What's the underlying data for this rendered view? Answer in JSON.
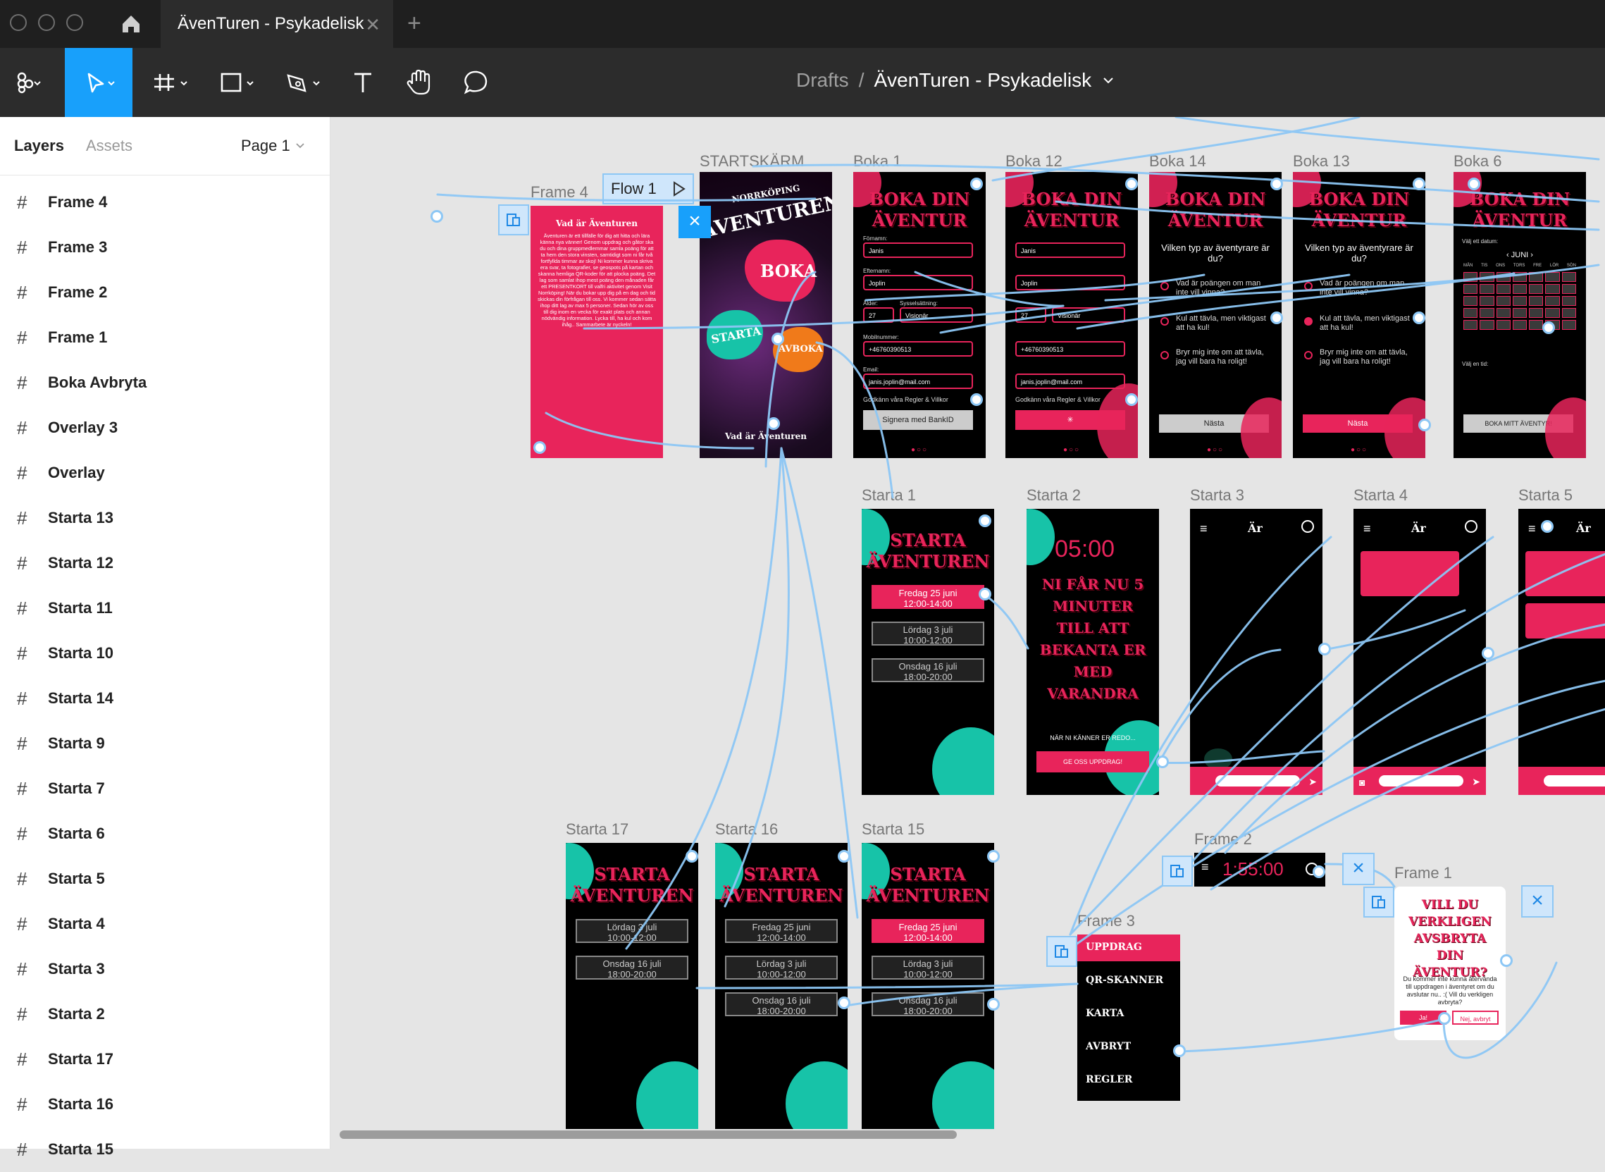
{
  "window": {
    "tab_title": "ÄvenTuren - Psykadelisk",
    "tab_close": "✕",
    "new_tab": "+"
  },
  "toolbar": {
    "breadcrumb_root": "Drafts",
    "breadcrumb_sep": "/",
    "file_name": "ÄvenTuren - Psykadelisk"
  },
  "panel": {
    "tab_layers": "Layers",
    "tab_assets": "Assets",
    "page_selector": "Page 1",
    "layers": [
      "Frame 4",
      "Frame 3",
      "Frame 2",
      "Frame 1",
      "Boka Avbryta",
      "Overlay 3",
      "Overlay",
      "Starta 13",
      "Starta 12",
      "Starta 11",
      "Starta 10",
      "Starta 14",
      "Starta 9",
      "Starta 7",
      "Starta 6",
      "Starta 5",
      "Starta 4",
      "Starta 3",
      "Starta 2",
      "Starta 17",
      "Starta 16",
      "Starta 15"
    ]
  },
  "canvas": {
    "flow_label": "Flow 1",
    "frame_labels": {
      "frame4": "Frame 4",
      "startskarm": "STARTSKÄRM",
      "boka1": "Boka 1",
      "boka12": "Boka 12",
      "boka14": "Boka 14",
      "boka13": "Boka 13",
      "boka6": "Boka 6",
      "starta1": "Starta 1",
      "starta2": "Starta 2",
      "starta3": "Starta 3",
      "starta4": "Starta 4",
      "starta5": "Starta 5",
      "starta17": "Starta 17",
      "starta16": "Starta 16",
      "starta15": "Starta 15",
      "frame2": "Frame 2",
      "frame3": "Frame 3",
      "frame1": "Frame 1"
    },
    "frame4": {
      "heading": "Vad är Äventuren",
      "body": "Äventuren är ett tillfälle för dig att hitta och lära känna nya vänner! Genom uppdrag och gåtor ska du och dina gruppmedlemmar samla poäng för att ta hem den stora vinsten, samtidigt som ni får två fortfyllda timmar av skoj! Ni kommer kunna skriva era svar, ta fotografier, se geospots på kartan och skanna hemliga QR-koder för att plocka poäng. Det lag som samlat ihop mest poäng den månaden får ett PRESENTKORT till valfri aktivitet genom Visit Norrköping! När du bokar upp dig på en dag och tid skickas din förfrågan till oss. Vi kommer sedan sätta ihop ditt lag av max 5 personer. Sedan hör av oss till dig inom en vecka för exakt plats och annan nödvändig information. Lycka till, ha kul och kom ihåg.. Sammarbete är nyckeln!"
    },
    "startskarm": {
      "top": "NORRKÖPING",
      "title": "ÄVENTUREN",
      "boka": "BOKA",
      "starta": "STARTA",
      "avboka": "AVBOKA",
      "bottom": "Vad är Äventuren"
    },
    "boka_title_1": "BOKA DIN",
    "boka_title_2": "ÄVENTUR",
    "boka_form": {
      "fornamn_label": "Förnamn:",
      "fornamn": "Janis",
      "efternamn_label": "Efternamn:",
      "efternamn": "Joplin",
      "alder_label": "Ålder:",
      "alder": "27",
      "syssel_label": "Sysselsättning:",
      "syssel": "Visionär",
      "mobil_label": "Mobilnummer:",
      "mobil": "+46760390513",
      "email_label": "Email:",
      "email": "janis.joplin@mail.com",
      "godkann": "Godkänn våra Regler & Villkor",
      "bankid": "Signera med BankID"
    },
    "boka_question": {
      "title": "Vilken typ av äventyrare är du?",
      "opt1": "Vad är poängen om man inte vill vinna?",
      "opt2": "Kul att tävla, men viktigast att ha kul!",
      "opt3": "Bryr mig inte om att tävla, jag vill bara ha roligt!",
      "next": "Nästa"
    },
    "boka6": {
      "choose_date": "Välj ett datum:",
      "month": "JUNI",
      "weekdays": [
        "MÅN",
        "TIS",
        "ONS",
        "TORS",
        "FRE",
        "LÖR",
        "SÖN"
      ],
      "choose_time": "Välj en tid:",
      "button": "BOKA MITT ÄVENTYR!"
    },
    "starta_title_1": "STARTA",
    "starta_title_2": "ÄVENTUREN",
    "slots": [
      {
        "day": "Fredag 25 juni",
        "time": "12:00-14:00"
      },
      {
        "day": "Lördag 3 juli",
        "time": "10:00-12:00"
      },
      {
        "day": "Onsdag 16 juli",
        "time": "18:00-20:00"
      }
    ],
    "starta2": {
      "timer": "05:00",
      "message": "NI FÅR NU 5 MINUTER TILL ATT BEKANTA ER MED VARANDRA",
      "ready": "NÄR NI KÄNNER ER REDO...",
      "button": "GE OSS UPPDRAG!"
    },
    "frame2": {
      "timer": "1:55:00"
    },
    "frame3": {
      "items": [
        "UPPDRAG",
        "QR-SKANNER",
        "KARTA",
        "AVBRYT",
        "REGLER"
      ]
    },
    "frame1": {
      "title": "VILL DU VERKLIGEN AVSBRYTA DIN ÄVENTUR?",
      "body": "Du kommer inte kunna återvända till uppdragen i äventyret om du avslutar nu.. :( Vill du verkligen avbryta?",
      "yes": "Ja!",
      "no": "Nej, avbryt"
    }
  },
  "colors": {
    "accent": "#18a0fb",
    "pink": "#e8245b",
    "teal": "#17c3a8",
    "wire": "#8dc7f5"
  }
}
